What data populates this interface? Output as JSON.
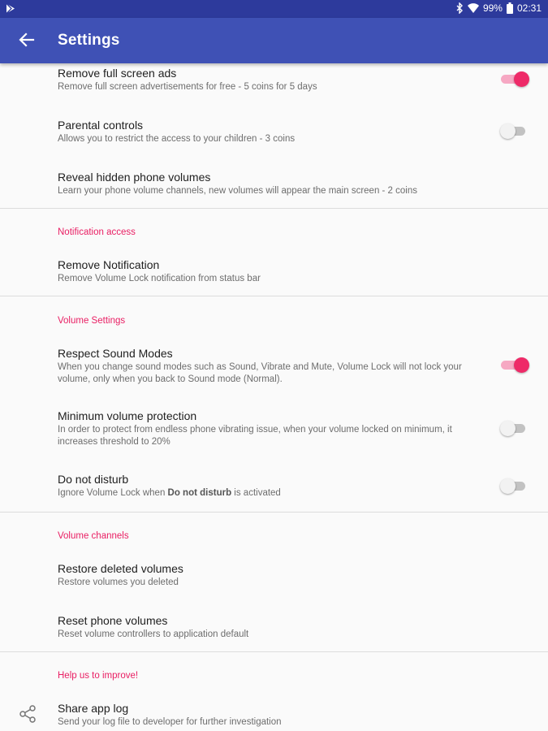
{
  "status_bar": {
    "battery": "99%",
    "time": "02:31",
    "icons": [
      "play-store-icon",
      "bluetooth-icon",
      "wifi-icon",
      "battery-icon"
    ]
  },
  "app_bar": {
    "title": "Settings",
    "back_icon": "arrow-back-icon"
  },
  "colors": {
    "primary": "#3f51b5",
    "status_bar": "#2d3a9c",
    "accent": "#e91e63"
  },
  "items": {
    "remove_ads": {
      "title": "Remove full screen ads",
      "subtitle": "Remove full screen advertisements for free - 5 coins for 5 days",
      "switch_on": true
    },
    "parental": {
      "title": "Parental controls",
      "subtitle": "Allows you to restrict the access to your children - 3 coins",
      "switch_on": false
    },
    "reveal": {
      "title": "Reveal hidden phone volumes",
      "subtitle": "Learn your phone volume channels, new volumes will appear the main screen - 2 coins"
    },
    "remove_notification": {
      "title": "Remove Notification",
      "subtitle": "Remove Volume Lock notification from status bar"
    },
    "respect_sound": {
      "title": "Respect Sound Modes",
      "subtitle_line1": "When you change sound modes such as Sound, Vibrate and Mute, Volume Lock will not lock your",
      "subtitle_line2": "volume, only when you back to Sound mode (Normal).",
      "switch_on": true
    },
    "min_volume": {
      "title": "Minimum volume protection",
      "subtitle_line1": "In order to protect from endless phone vibrating issue, when your volume locked on minimum, it",
      "subtitle_line2": "increases threshold to 20%",
      "switch_on": false
    },
    "dnd": {
      "title": "Do not disturb",
      "subtitle_pre": "Ignore Volume Lock when ",
      "subtitle_bold": "Do not disturb",
      "subtitle_post": " is activated",
      "switch_on": false
    },
    "restore": {
      "title": "Restore deleted volumes",
      "subtitle": "Restore volumes you deleted"
    },
    "reset": {
      "title": "Reset phone volumes",
      "subtitle": "Reset volume controllers to application default"
    },
    "share_log": {
      "title": "Share app log",
      "subtitle": "Send your log file to developer for further investigation",
      "icon": "share-icon"
    }
  },
  "sections": {
    "notification": "Notification access",
    "volume_settings": "Volume Settings",
    "volume_channels": "Volume channels",
    "help": "Help us to improve!"
  }
}
